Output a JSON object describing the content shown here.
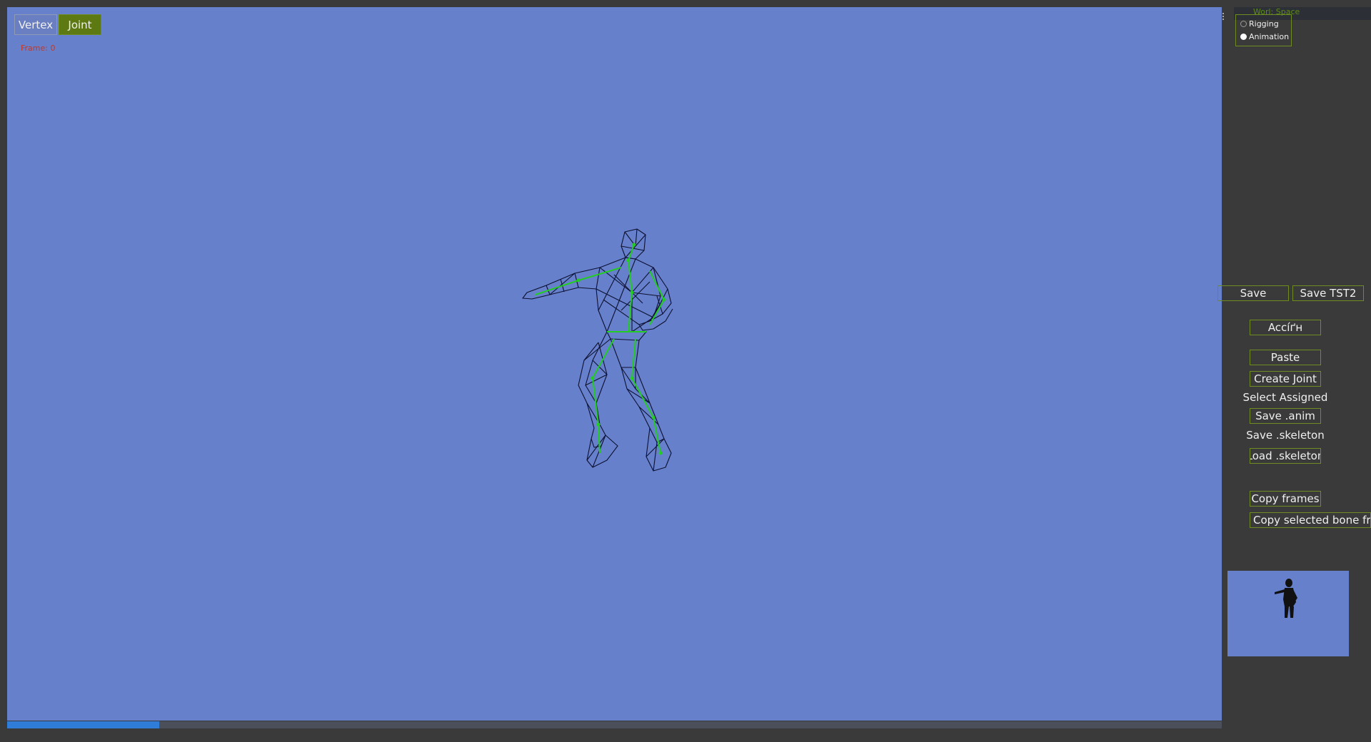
{
  "viewport": {
    "modes": {
      "vertex": "Vertex",
      "joint": "Joint"
    },
    "frame_label": "Frame: 0",
    "background": "#6680cc"
  },
  "timeline": {
    "progress": 0.125,
    "fill_color": "#2f7dd8"
  },
  "panel": {
    "header": "Worl: Space",
    "radios": [
      {
        "label": "Rigging",
        "checked": false
      },
      {
        "label": "Animation",
        "checked": true
      }
    ],
    "buttons": {
      "save": "Save",
      "save_tst2": "Save TST2",
      "assign": "Accíґн",
      "paste": "Paste",
      "create_joint": "Create Joint",
      "select_assigned": "Select Assigned",
      "save_anim": "Save .anim",
      "save_skeleton": "Save .skeleton",
      "load_skeleton": "Load .skeleton",
      "copy_frames": "Copy frames",
      "copy_selected_bone_frames": "Copy selected bone frar"
    }
  },
  "colors": {
    "app_bg": "#3a3a3a",
    "accent_green": "#6f8c20",
    "joint_green": "#22cc22",
    "mesh_dark": "#0d1030"
  }
}
